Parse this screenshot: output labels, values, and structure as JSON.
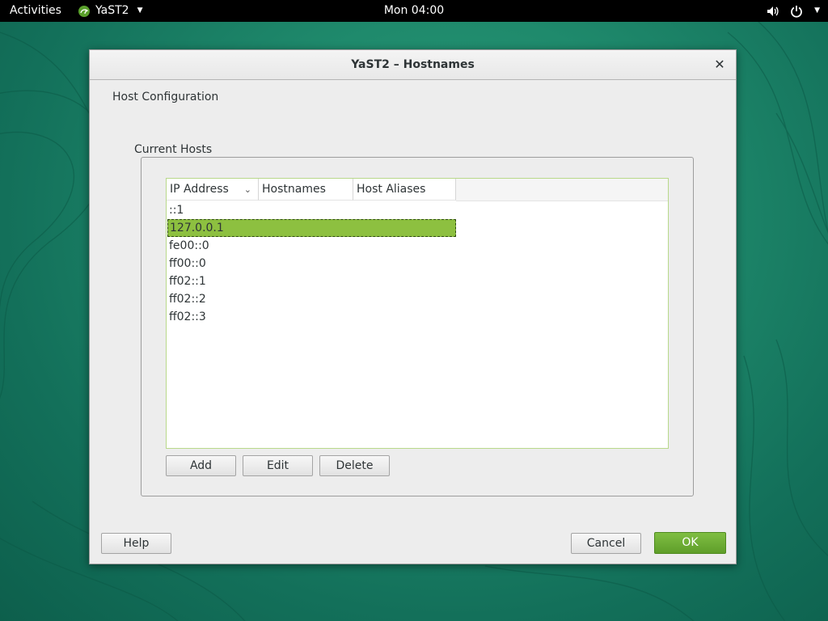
{
  "topbar": {
    "activities": "Activities",
    "app_name": "YaST2",
    "clock": "Mon 04:00"
  },
  "dialog": {
    "title": "YaST2 – Hostnames",
    "heading": "Host Configuration",
    "frame_label": "Current Hosts",
    "table": {
      "columns": [
        "IP Address",
        "Hostnames",
        "Host Aliases"
      ],
      "rows": [
        "::1",
        "127.0.0.1",
        "fe00::0",
        "ff00::0",
        "ff02::1",
        "ff02::2",
        "ff02::3"
      ],
      "selected_index": 1
    },
    "buttons": {
      "add": "Add",
      "edit": "Edit",
      "delete": "Delete",
      "help": "Help",
      "cancel": "Cancel",
      "ok": "OK"
    }
  },
  "icons": {
    "app": "chameleon-icon",
    "volume": "volume-icon",
    "power": "power-icon",
    "sort": "chevron-down-icon",
    "close": "close-icon"
  },
  "colors": {
    "accent": "#73b335",
    "selection": "#8dc040",
    "desktop": "#1f8a6c"
  }
}
